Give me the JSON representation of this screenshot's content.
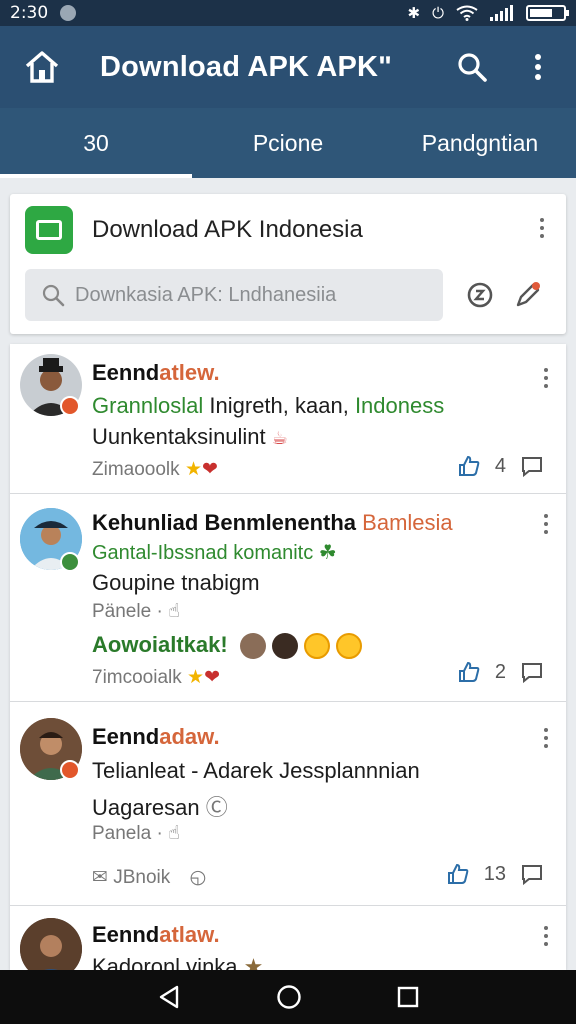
{
  "status_bar": {
    "time": "2:30"
  },
  "toolbar": {
    "title": "Download APK APKʺ"
  },
  "tabs": [
    {
      "label": "30",
      "active": true
    },
    {
      "label": "Pcione",
      "active": false
    },
    {
      "label": "Pandgntian",
      "active": false
    }
  ],
  "header_card": {
    "title": "Download APK Indonesia",
    "search_placeholder": "Downkasia APK: Lndhanesiia"
  },
  "posts": [
    {
      "author_main": "Eennd",
      "author_accent": "atlew.",
      "line2_a": "Grannloslal",
      "line2_b": " Inigreth, kaan, ",
      "line2_c": "Indoness",
      "line3": "Uunkentaksinulint",
      "meta": "Zimaooolk",
      "likes": "4"
    },
    {
      "author_main": "Kehunliad Benmlenentha ",
      "author_accent": "Bamlesia",
      "line2": "Gantal-Ibssnad komanitc",
      "line3": "Goupine tnabigm",
      "sub": "Pänele ·",
      "reaction_text": "Aowoialtkak!",
      "meta": "7imcooialk",
      "likes": "2"
    },
    {
      "author_main": "Eennd",
      "author_accent": "adaw.",
      "line2": "Telianleat - Adarek Jessplannnian",
      "line3": "Uagaresan",
      "sub": "Panela ·",
      "share_label": "JBnoik",
      "likes": "13"
    },
    {
      "author_main": "Eennd",
      "author_accent": "atlaw.",
      "line2": "Kadoronl vinka"
    }
  ],
  "colors": {
    "toolbar": "#2b4f72",
    "tabs": "#2f5678",
    "accent_orange": "#d5663b",
    "accent_green": "#2f8a2f",
    "app_icon": "#2ea843"
  }
}
